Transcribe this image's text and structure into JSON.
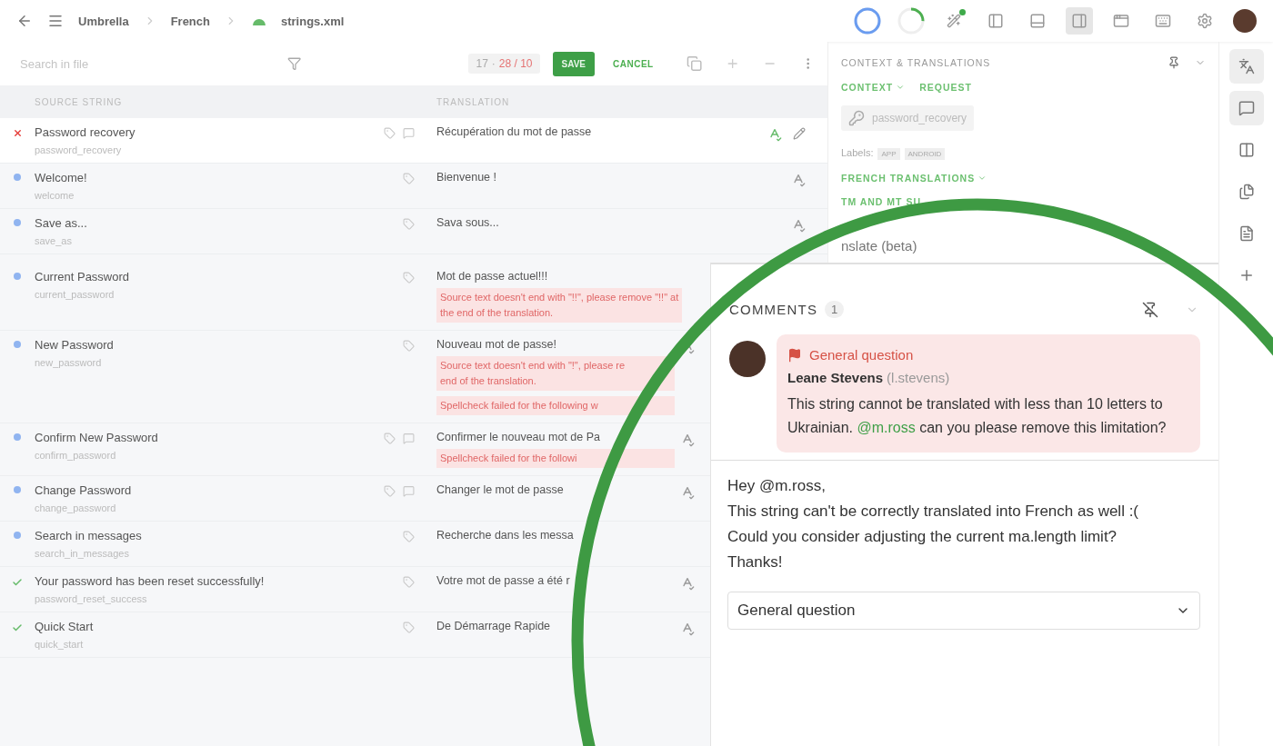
{
  "top_bar": {
    "breadcrumbs": [
      "Umbrella",
      "French",
      "strings.xml"
    ],
    "layouts": [
      {
        "kind": "left",
        "selected": false
      },
      {
        "kind": "bottom",
        "selected": false
      },
      {
        "kind": "right",
        "selected": true
      }
    ]
  },
  "toolbar": {
    "search": {
      "placeholder": "Search in file"
    },
    "counter": {
      "done": "17",
      "separator": "·",
      "issues": "28 / 10"
    },
    "save": "SAVE",
    "cancel": "CANCEL"
  },
  "columns": [
    "SOURCE STRING",
    "TRANSLATION"
  ],
  "rows": [
    {
      "kind": "error",
      "source": "Password recovery",
      "key": "password_recovery",
      "comment_icon": true,
      "translation": "Récupération du mot de passe",
      "issues": [],
      "spellcheck": true,
      "selected": true
    },
    {
      "kind": "untranslated",
      "source": "Welcome!",
      "key": "welcome",
      "comment_icon": false,
      "translation": "Bienvenue !",
      "issues": [],
      "spellcheck": true,
      "selected": false
    },
    {
      "kind": "untranslated",
      "source": "Save as...",
      "key": "save_as",
      "comment_icon": false,
      "translation": "Sava sous...",
      "issues": [],
      "spellcheck": true,
      "selected": false
    },
    {
      "kind": "untranslated",
      "source": "Current Password",
      "key": "current_password",
      "comment_icon": false,
      "translation": "Mot de passe actuel!!!",
      "issues": [
        {
          "lines": [
            "Source text doesn't end with \"!!\", please remove \"!!\" at",
            "the end of the translation."
          ]
        }
      ],
      "spellcheck": false,
      "selected": false
    },
    {
      "kind": "untranslated",
      "source": "New Password",
      "key": "new_password",
      "comment_icon": false,
      "translation": "Nouveau mot de passe!",
      "issues": [
        {
          "lines": [
            "Source text doesn't end with \"!\", please re",
            "end of the translation."
          ]
        },
        {
          "lines": [
            "Spellcheck failed for the following w"
          ]
        }
      ],
      "spellcheck": true,
      "selected": false
    },
    {
      "kind": "untranslated",
      "source": "Confirm New Password",
      "key": "confirm_password",
      "comment_icon": true,
      "translation": "Confirmer le nouveau mot de Pa",
      "issues": [
        {
          "lines": [
            "Spellcheck failed for the followi"
          ]
        }
      ],
      "spellcheck": true,
      "selected": false
    },
    {
      "kind": "untranslated",
      "source": "Change Password",
      "key": "change_password",
      "comment_icon": true,
      "translation": "Changer le mot de passe",
      "issues": [],
      "spellcheck": true,
      "selected": false
    },
    {
      "kind": "untranslated",
      "source": "Search in messages",
      "key": "search_in_messages",
      "comment_icon": false,
      "translation": "Recherche dans les messa",
      "issues": [],
      "spellcheck": false,
      "selected": false
    },
    {
      "kind": "approved",
      "source": "Your password has been reset successfully!",
      "key": "password_reset_success",
      "comment_icon": false,
      "translation": "Votre mot de passe a été r",
      "issues": [],
      "spellcheck": true,
      "selected": false
    },
    {
      "kind": "approved",
      "source": "Quick Start",
      "key": "quick_start",
      "comment_icon": false,
      "translation": "De Démarrage Rapide",
      "issues": [],
      "spellcheck": true,
      "selected": false
    }
  ],
  "context_panel": {
    "title": "CONTEXT & TRANSLATIONS",
    "tabs": [
      "CONTEXT",
      "REQUEST"
    ],
    "key": "password_recovery",
    "labels_title": "Labels:",
    "labels": [
      "APP",
      "ANDROID"
    ],
    "sections": [
      "FRENCH TRANSLATIONS",
      "TM AND MT SU"
    ],
    "cut_text": "nslate (beta)"
  },
  "side_icons": [
    {
      "kind": "translate",
      "selected": true
    },
    {
      "kind": "comments",
      "selected": true
    },
    {
      "kind": "panel",
      "selected": false
    },
    {
      "kind": "copy",
      "selected": false
    },
    {
      "kind": "file",
      "selected": false
    },
    {
      "kind": "add",
      "selected": false
    }
  ],
  "comments": {
    "title": "COMMENTS",
    "count": "1",
    "items": [
      {
        "category": "General question",
        "author": "Leane Stevens",
        "username": "(l.stevens)",
        "text_before": "This string cannot be translated with less than 10 letters to Ukrainian.",
        "mention": "@m.ross",
        "text_after": "can you please remove this limitation?"
      }
    ],
    "reply": {
      "value": "Hey @m.ross,\nThis string can't be correctly translated into French as well :(\nCould you consider adjusting the current ma.length limit?\nThanks!"
    },
    "issue_type": {
      "value": "General question"
    }
  }
}
